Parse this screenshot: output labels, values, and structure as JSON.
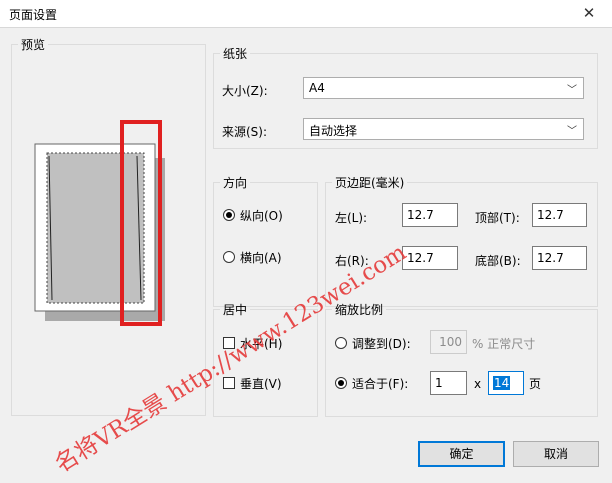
{
  "window": {
    "title": "页面设置",
    "close_glyph": "✕"
  },
  "preview": {
    "label": "预览"
  },
  "paper": {
    "legend": "纸张",
    "size_label": "大小(Z):",
    "size_value": "A4",
    "source_label": "来源(S):",
    "source_value": "自动选择"
  },
  "orientation": {
    "legend": "方向",
    "portrait_label": "纵向(O)",
    "landscape_label": "横向(A)",
    "selected": "portrait"
  },
  "margins": {
    "legend": "页边距(毫米)",
    "left_label": "左(L):",
    "left_value": "12.7",
    "top_label": "顶部(T):",
    "top_value": "12.7",
    "right_label": "右(R):",
    "right_value": "12.7",
    "bottom_label": "底部(B):",
    "bottom_value": "12.7"
  },
  "center": {
    "legend": "居中",
    "horizontal_label": "水平(H)",
    "vertical_label": "垂直(V)"
  },
  "scaling": {
    "legend": "缩放比例",
    "adjust_label": "调整到(D):",
    "adjust_value": "100",
    "adjust_suffix": "% 正常尺寸",
    "fit_label": "适合于(F):",
    "fit_wide": "1",
    "fit_x": "x",
    "fit_tall": "14",
    "fit_suffix": "页",
    "selected": "fit"
  },
  "buttons": {
    "ok": "确定",
    "cancel": "取消"
  },
  "watermark": {
    "text": "名将VR全景 http://www.123wei.com"
  },
  "colors": {
    "highlight_box": "#e02020",
    "accent": "#0078d7",
    "watermark": "#e53a3a"
  }
}
